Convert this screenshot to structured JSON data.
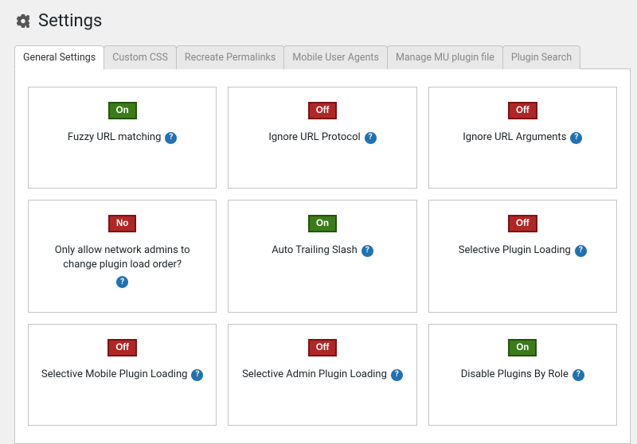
{
  "header": {
    "title": "Settings"
  },
  "tabs": [
    {
      "label": "General Settings",
      "active": true
    },
    {
      "label": "Custom CSS",
      "active": false
    },
    {
      "label": "Recreate Permalinks",
      "active": false
    },
    {
      "label": "Mobile User Agents",
      "active": false
    },
    {
      "label": "Manage MU plugin file",
      "active": false
    },
    {
      "label": "Plugin Search",
      "active": false
    }
  ],
  "help_symbol": "?",
  "cards": [
    {
      "toggle_text": "On",
      "toggle_state": "on",
      "label": "Fuzzy URL matching"
    },
    {
      "toggle_text": "Off",
      "toggle_state": "off",
      "label": "Ignore URL Protocol"
    },
    {
      "toggle_text": "Off",
      "toggle_state": "off",
      "label": "Ignore URL Arguments"
    },
    {
      "toggle_text": "No",
      "toggle_state": "off",
      "label": "Only allow network admins to change plugin load order?"
    },
    {
      "toggle_text": "On",
      "toggle_state": "on",
      "label": "Auto Trailing Slash"
    },
    {
      "toggle_text": "Off",
      "toggle_state": "off",
      "label": "Selective Plugin Loading"
    },
    {
      "toggle_text": "Off",
      "toggle_state": "off",
      "label": "Selective Mobile Plugin Loading"
    },
    {
      "toggle_text": "Off",
      "toggle_state": "off",
      "label": "Selective Admin Plugin Loading"
    },
    {
      "toggle_text": "On",
      "toggle_state": "on",
      "label": "Disable Plugins By Role"
    }
  ]
}
